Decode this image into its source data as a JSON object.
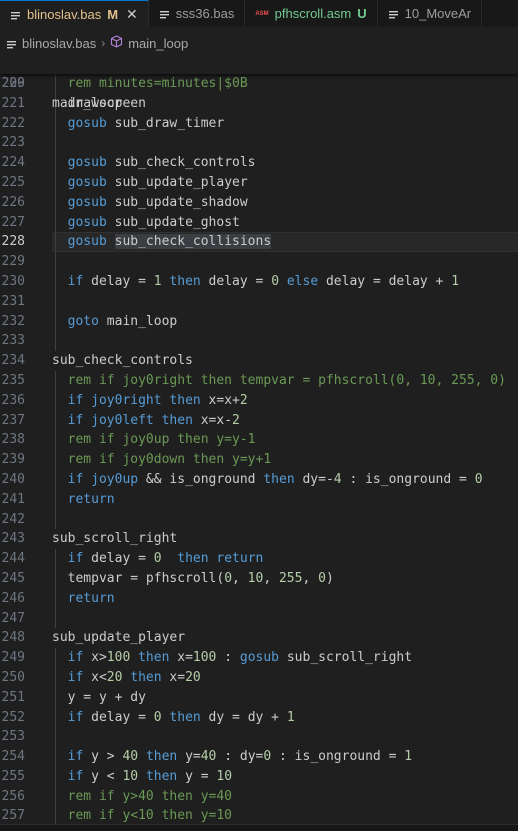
{
  "tabs": [
    {
      "label": "blinoslav.bas",
      "badge": "M",
      "active": true,
      "close": "✕"
    },
    {
      "label": "sss36.bas",
      "badge": "",
      "active": false
    },
    {
      "label": "pfhscroll.asm",
      "badge": "U",
      "active": false,
      "icon_text": "ASM"
    },
    {
      "label": "10_MoveAr",
      "badge": "",
      "active": false
    }
  ],
  "breadcrumb": {
    "file": "blinoslav.bas",
    "symbol": "main_loop"
  },
  "sticky": {
    "line": "209",
    "text": "main_loop"
  },
  "lines": [
    {
      "n": "220",
      "t": [
        [
          "  rem minutes=minutes|$0B",
          "cm"
        ]
      ]
    },
    {
      "n": "221",
      "t": [
        [
          "  drawscreen",
          ""
        ]
      ]
    },
    {
      "n": "222",
      "t": [
        [
          "  gosub",
          "kw"
        ],
        [
          " sub_draw_timer",
          ""
        ]
      ]
    },
    {
      "n": "223",
      "t": []
    },
    {
      "n": "224",
      "t": [
        [
          "  gosub",
          "kw"
        ],
        [
          " sub_check_controls",
          ""
        ]
      ]
    },
    {
      "n": "225",
      "t": [
        [
          "  gosub",
          "kw"
        ],
        [
          " sub_update_player",
          ""
        ]
      ]
    },
    {
      "n": "226",
      "t": [
        [
          "  gosub",
          "kw"
        ],
        [
          " sub_update_shadow",
          ""
        ]
      ]
    },
    {
      "n": "227",
      "t": [
        [
          "  gosub",
          "kw"
        ],
        [
          " sub_update_ghost",
          ""
        ]
      ]
    },
    {
      "n": "228",
      "cur": true,
      "t": [
        [
          "  gosub",
          "kw"
        ],
        [
          " ",
          ""
        ],
        [
          "sub_check_collisions",
          "sel"
        ]
      ]
    },
    {
      "n": "229",
      "t": []
    },
    {
      "n": "230",
      "t": [
        [
          "  if",
          "kw"
        ],
        [
          " delay = ",
          ""
        ],
        [
          "1",
          "num"
        ],
        [
          " ",
          ""
        ],
        [
          "then",
          "kw"
        ],
        [
          " delay = ",
          ""
        ],
        [
          "0",
          "num"
        ],
        [
          " ",
          ""
        ],
        [
          "else",
          "kw"
        ],
        [
          " delay = delay + ",
          ""
        ],
        [
          "1",
          "num"
        ]
      ]
    },
    {
      "n": "231",
      "t": []
    },
    {
      "n": "232",
      "t": [
        [
          "  goto",
          "kw"
        ],
        [
          " main_loop",
          ""
        ]
      ]
    },
    {
      "n": "233",
      "t": []
    },
    {
      "n": "234",
      "t": [
        [
          "sub_check_controls",
          ""
        ]
      ]
    },
    {
      "n": "235",
      "t": [
        [
          "  rem if joy0right then tempvar = pfhscroll(0, 10, 255, 0)",
          "cm"
        ]
      ]
    },
    {
      "n": "236",
      "t": [
        [
          "  if",
          "kw"
        ],
        [
          " ",
          ""
        ],
        [
          "joy0right",
          "kw"
        ],
        [
          " ",
          ""
        ],
        [
          "then",
          "kw"
        ],
        [
          " x=x+",
          ""
        ],
        [
          "2",
          "num"
        ]
      ]
    },
    {
      "n": "237",
      "t": [
        [
          "  if",
          "kw"
        ],
        [
          " ",
          ""
        ],
        [
          "joy0left",
          "kw"
        ],
        [
          " ",
          ""
        ],
        [
          "then",
          "kw"
        ],
        [
          " x=x-",
          ""
        ],
        [
          "2",
          "num"
        ]
      ]
    },
    {
      "n": "238",
      "t": [
        [
          "  rem if joy0up then y=y-1",
          "cm"
        ]
      ]
    },
    {
      "n": "239",
      "t": [
        [
          "  rem if joy0down then y=y+1",
          "cm"
        ]
      ]
    },
    {
      "n": "240",
      "t": [
        [
          "  if",
          "kw"
        ],
        [
          " ",
          ""
        ],
        [
          "joy0up",
          "kw"
        ],
        [
          " && is_onground ",
          ""
        ],
        [
          "then",
          "kw"
        ],
        [
          " dy=-",
          ""
        ],
        [
          "4",
          "num"
        ],
        [
          " : is_onground = ",
          ""
        ],
        [
          "0",
          "num"
        ]
      ]
    },
    {
      "n": "241",
      "t": [
        [
          "  return",
          "kw"
        ]
      ]
    },
    {
      "n": "242",
      "t": []
    },
    {
      "n": "243",
      "t": [
        [
          "sub_scroll_right",
          ""
        ]
      ]
    },
    {
      "n": "244",
      "t": [
        [
          "  if",
          "kw"
        ],
        [
          " delay = ",
          ""
        ],
        [
          "0",
          "num"
        ],
        [
          "  ",
          ""
        ],
        [
          "then",
          "kw"
        ],
        [
          " ",
          ""
        ],
        [
          "return",
          "kw"
        ]
      ]
    },
    {
      "n": "245",
      "t": [
        [
          "  tempvar = pfhscroll(",
          ""
        ],
        [
          "0",
          "num"
        ],
        [
          ", ",
          ""
        ],
        [
          "10",
          "num"
        ],
        [
          ", ",
          ""
        ],
        [
          "255",
          "num"
        ],
        [
          ", ",
          ""
        ],
        [
          "0",
          "num"
        ],
        [
          ")",
          ""
        ]
      ]
    },
    {
      "n": "246",
      "t": [
        [
          "  return",
          "kw"
        ]
      ]
    },
    {
      "n": "247",
      "t": []
    },
    {
      "n": "248",
      "t": [
        [
          "sub_update_player",
          ""
        ]
      ]
    },
    {
      "n": "249",
      "t": [
        [
          "  if",
          "kw"
        ],
        [
          " x>",
          ""
        ],
        [
          "100",
          "num"
        ],
        [
          " ",
          ""
        ],
        [
          "then",
          "kw"
        ],
        [
          " x=",
          ""
        ],
        [
          "100",
          "num"
        ],
        [
          " : ",
          ""
        ],
        [
          "gosub",
          "kw"
        ],
        [
          " sub_scroll_right",
          ""
        ]
      ]
    },
    {
      "n": "250",
      "t": [
        [
          "  if",
          "kw"
        ],
        [
          " x<",
          ""
        ],
        [
          "20",
          "num"
        ],
        [
          " ",
          ""
        ],
        [
          "then",
          "kw"
        ],
        [
          " x=",
          ""
        ],
        [
          "20",
          "num"
        ]
      ]
    },
    {
      "n": "251",
      "t": [
        [
          "  y = y + dy",
          ""
        ]
      ]
    },
    {
      "n": "252",
      "t": [
        [
          "  if",
          "kw"
        ],
        [
          " delay = ",
          ""
        ],
        [
          "0",
          "num"
        ],
        [
          " ",
          ""
        ],
        [
          "then",
          "kw"
        ],
        [
          " dy = dy + ",
          ""
        ],
        [
          "1",
          "num"
        ]
      ]
    },
    {
      "n": "253",
      "t": []
    },
    {
      "n": "254",
      "t": [
        [
          "  if",
          "kw"
        ],
        [
          " y > ",
          ""
        ],
        [
          "40",
          "num"
        ],
        [
          " ",
          ""
        ],
        [
          "then",
          "kw"
        ],
        [
          " y=",
          ""
        ],
        [
          "40",
          "num"
        ],
        [
          " : dy=",
          ""
        ],
        [
          "0",
          "num"
        ],
        [
          " : is_onground = ",
          ""
        ],
        [
          "1",
          "num"
        ]
      ]
    },
    {
      "n": "255",
      "t": [
        [
          "  if",
          "kw"
        ],
        [
          " y < ",
          ""
        ],
        [
          "10",
          "num"
        ],
        [
          " ",
          ""
        ],
        [
          "then",
          "kw"
        ],
        [
          " y = ",
          ""
        ],
        [
          "10",
          "num"
        ]
      ]
    },
    {
      "n": "256",
      "t": [
        [
          "  rem if y>40 then y=40",
          "cm"
        ]
      ]
    },
    {
      "n": "257",
      "t": [
        [
          "  rem if y<10 then y=10",
          "cm"
        ]
      ]
    }
  ]
}
